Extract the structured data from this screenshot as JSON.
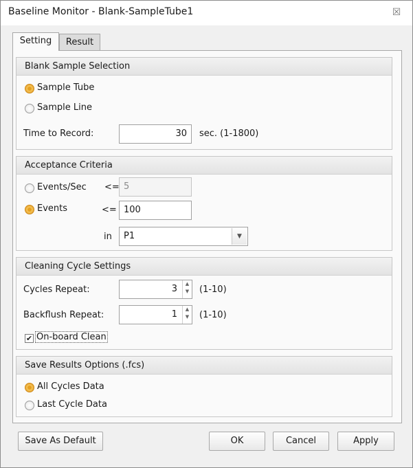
{
  "window": {
    "title": "Baseline Monitor - Blank-SampleTube1",
    "close_glyph": "☒"
  },
  "tabs": [
    {
      "label": "Setting"
    },
    {
      "label": "Result"
    }
  ],
  "blank_sample": {
    "header": "Blank Sample Selection",
    "options": [
      {
        "label": "Sample Tube",
        "selected": true
      },
      {
        "label": "Sample Line",
        "selected": false
      }
    ],
    "time_label": "Time to Record:",
    "time_value": "30",
    "time_unit": "sec.  (1-1800)"
  },
  "acceptance": {
    "header": "Acceptance Criteria",
    "events_sec": {
      "label": "Events/Sec",
      "op": "<=",
      "value": "5",
      "selected": false
    },
    "events": {
      "label": "Events",
      "op": "<=",
      "value": "100",
      "selected": true
    },
    "in_label": "in",
    "in_value": "P1"
  },
  "cleaning": {
    "header": "Cleaning Cycle Settings",
    "cycles_label": "Cycles Repeat:",
    "cycles_value": "3",
    "cycles_range": "(1-10)",
    "backflush_label": "Backflush Repeat:",
    "backflush_value": "1",
    "backflush_range": "(1-10)",
    "onboard_label": "On-board Clean",
    "onboard_checked": true
  },
  "save_results": {
    "header": "Save Results Options (.fcs)",
    "options": [
      {
        "label": "All Cycles Data",
        "selected": true
      },
      {
        "label": "Last Cycle Data",
        "selected": false
      }
    ]
  },
  "footer": {
    "save_default": "Save As Default",
    "ok": "OK",
    "cancel": "Cancel",
    "apply": "Apply"
  },
  "colors": {
    "radio_selected": "#e5a021",
    "tab_active": "#fafafa",
    "header_bg": "#e6e6e6"
  },
  "icons": {
    "close": "close-icon",
    "spin_up": "chevron-up-icon",
    "spin_down": "chevron-down-icon",
    "dropdown": "dropdown-arrow-icon",
    "check": "checkmark-icon"
  }
}
